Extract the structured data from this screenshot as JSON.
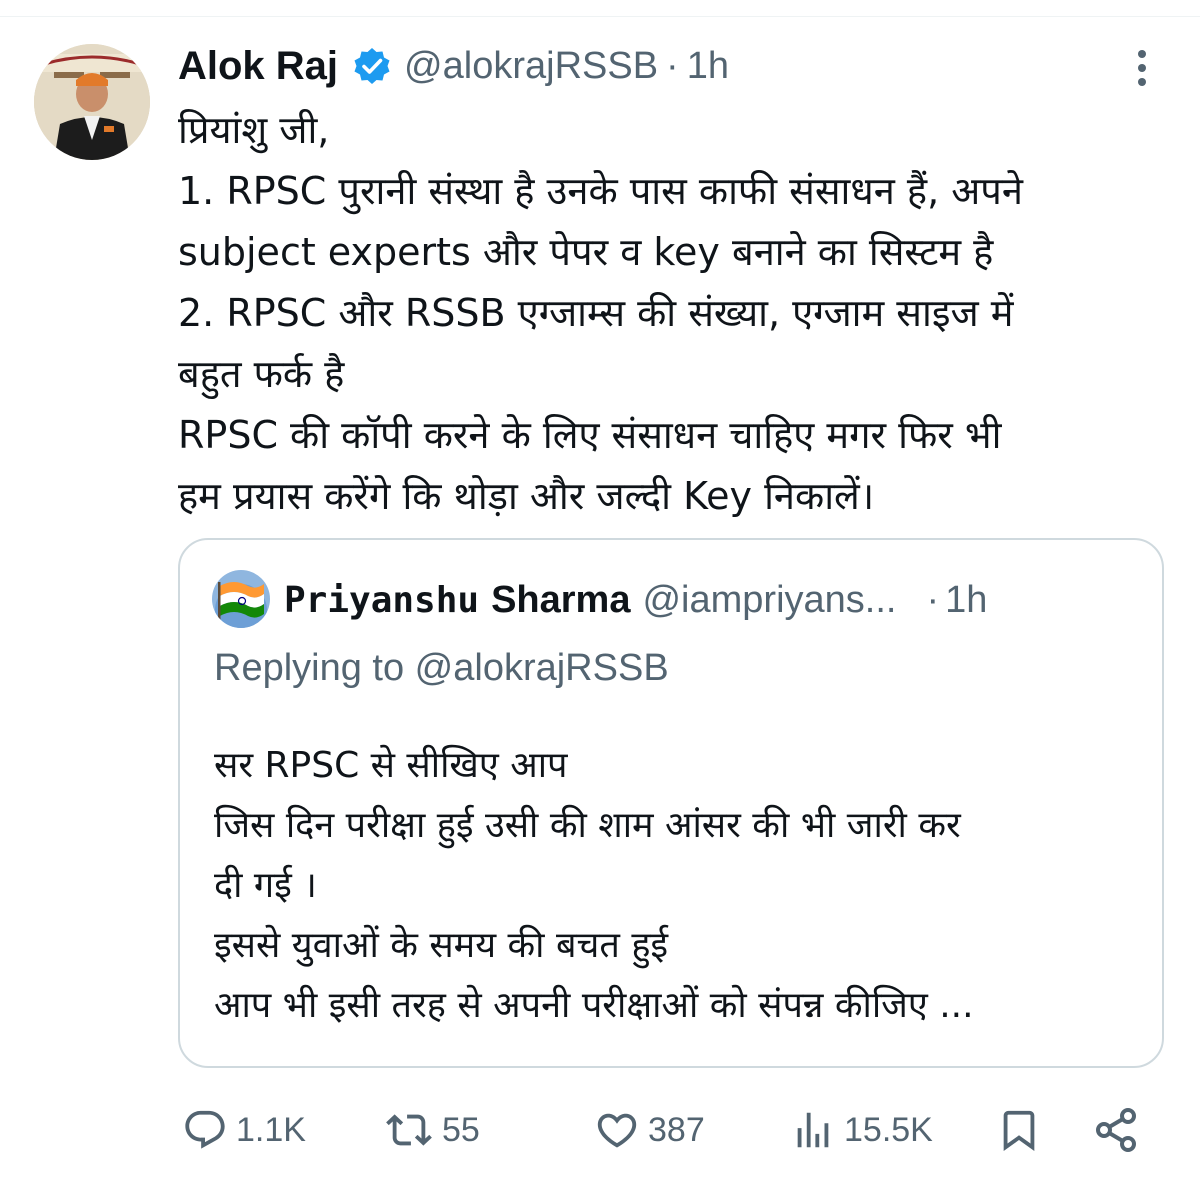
{
  "tweet": {
    "author": {
      "name": "Alok Raj",
      "handle": "@alokrajRSSB",
      "time": "1h",
      "verified": true
    },
    "separator": "·",
    "lines": [
      "प्रियांशु जी,",
      "1. RPSC पुरानी संस्था है उनके पास काफी संसाधन हैं, अपने",
      "subject experts और पेपर व key बनाने का सिस्टम है",
      "2. RPSC और RSSB एग्जाम्स की संख्या, एग्जाम साइज में",
      "बहुत फर्क है",
      "RPSC की कॉपी करने के लिए संसाधन चाहिए मगर फिर भी",
      "हम प्रयास करेंगे कि थोड़ा और जल्दी Key निकालें।"
    ]
  },
  "quote": {
    "name_part1": "Priyanshu",
    "name_part2": "Sharma",
    "handle": "@iampriyans...",
    "separator": "·",
    "time": "1h",
    "replying": "Replying to @alokrajRSSB",
    "lines": [
      "सर RPSC  से सीखिए आप",
      "जिस दिन परीक्षा हुई उसी की शाम आंसर की भी जारी कर",
      "दी गई ।",
      "इससे युवाओं के समय की बचत हुई",
      "आप भी इसी तरह से अपनी परीक्षाओं को संपन्न कीजिए ..."
    ]
  },
  "actions": {
    "reply_count": "1.1K",
    "retweet_count": "55",
    "like_count": "387",
    "view_count": "15.5K"
  },
  "colors": {
    "text": "#0f1419",
    "secondary": "#536471",
    "verified_blue": "#1d9bf0",
    "border": "#cfd9de"
  },
  "icons": [
    "verified-badge-icon",
    "more-options-icon",
    "reply-icon",
    "retweet-icon",
    "like-icon",
    "views-icon",
    "bookmark-icon",
    "share-icon"
  ]
}
